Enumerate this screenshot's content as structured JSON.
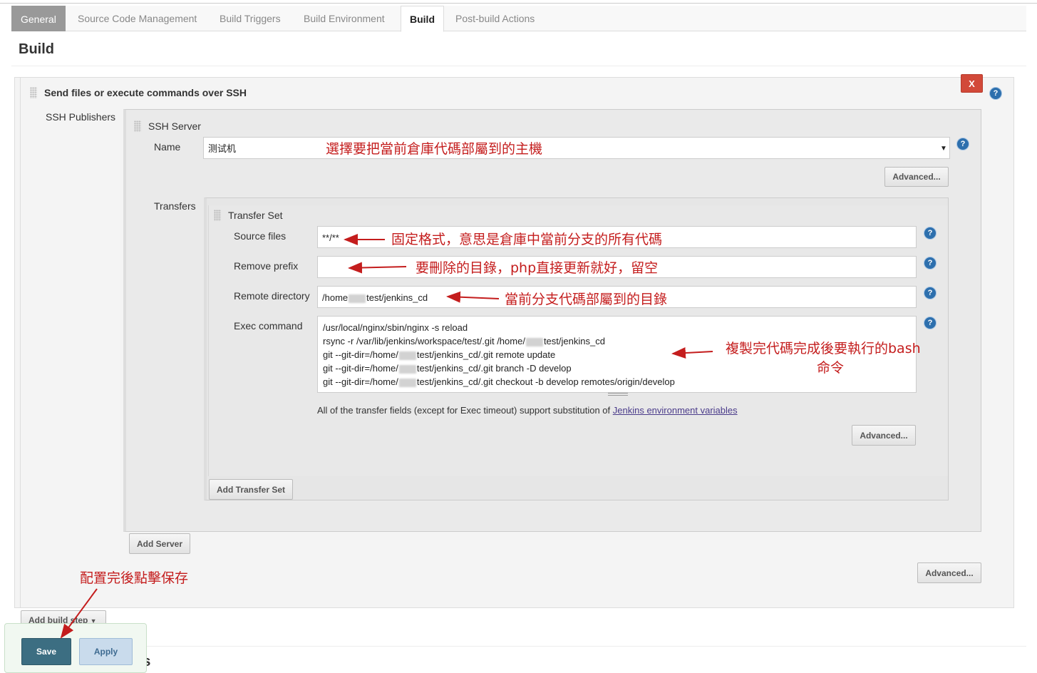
{
  "tabs": [
    {
      "label": "General"
    },
    {
      "label": "Source Code Management"
    },
    {
      "label": "Build Triggers"
    },
    {
      "label": "Build Environment"
    },
    {
      "label": "Build"
    },
    {
      "label": "Post-build Actions"
    }
  ],
  "section": {
    "title": "Build"
  },
  "step": {
    "title": "Send files or execute commands over SSH",
    "delete_label": "X",
    "ssh_publishers_label": "SSH Publishers",
    "ssh_server_label": "SSH Server",
    "name_label": "Name",
    "name_value": "测试机",
    "server_advanced": "Advanced...",
    "transfers_label": "Transfers",
    "transfer_set_label": "Transfer Set",
    "source_files_label": "Source files",
    "source_files_value": "**/**",
    "remove_prefix_label": "Remove prefix",
    "remove_prefix_value": "",
    "remote_dir_label": "Remote directory",
    "remote_dir_value_a": "/home",
    "remote_dir_value_b": "test/jenkins_cd",
    "exec_label": "Exec command",
    "exec_lines": [
      {
        "a": "/usr/local/nginx/sbin/nginx -s reload",
        "b": ""
      },
      {
        "a": "rsync -r /var/lib/jenkins/workspace/test/.git /home/",
        "b": "test/jenkins_cd"
      },
      {
        "a": "git --git-dir=/home/",
        "b": "test/jenkins_cd/.git remote update"
      },
      {
        "a": "git --git-dir=/home/",
        "b": "test/jenkins_cd/.git branch -D develop"
      },
      {
        "a": "git --git-dir=/home/",
        "b": "test/jenkins_cd/.git checkout -b develop remotes/origin/develop"
      }
    ],
    "note_text": "All of the transfer fields (except for Exec timeout) support substitution of ",
    "note_link": "Jenkins environment variables",
    "transfer_advanced": "Advanced...",
    "add_transfer_set": "Add Transfer Set",
    "add_server": "Add Server",
    "publisher_advanced": "Advanced..."
  },
  "add_build_step": "Add build step",
  "post_build_partial": "ns",
  "actions": {
    "save": "Save",
    "apply": "Apply"
  },
  "annotations": {
    "name": "選擇要把當前倉庫代碼部屬到的主機",
    "source": "固定格式，意思是倉庫中當前分支的所有代碼",
    "prefix": "要刪除的目錄，php直接更新就好，留空",
    "remote": "當前分支代碼部屬到的目錄",
    "exec_1": "複製完代碼完成後要執行的bash",
    "exec_2": "命令",
    "save": "配置完後點擊保存"
  },
  "colors": {
    "annotation": "#c41d1d",
    "delete": "#d24939",
    "save": "#3c6e82",
    "help": "#2d6fad"
  }
}
